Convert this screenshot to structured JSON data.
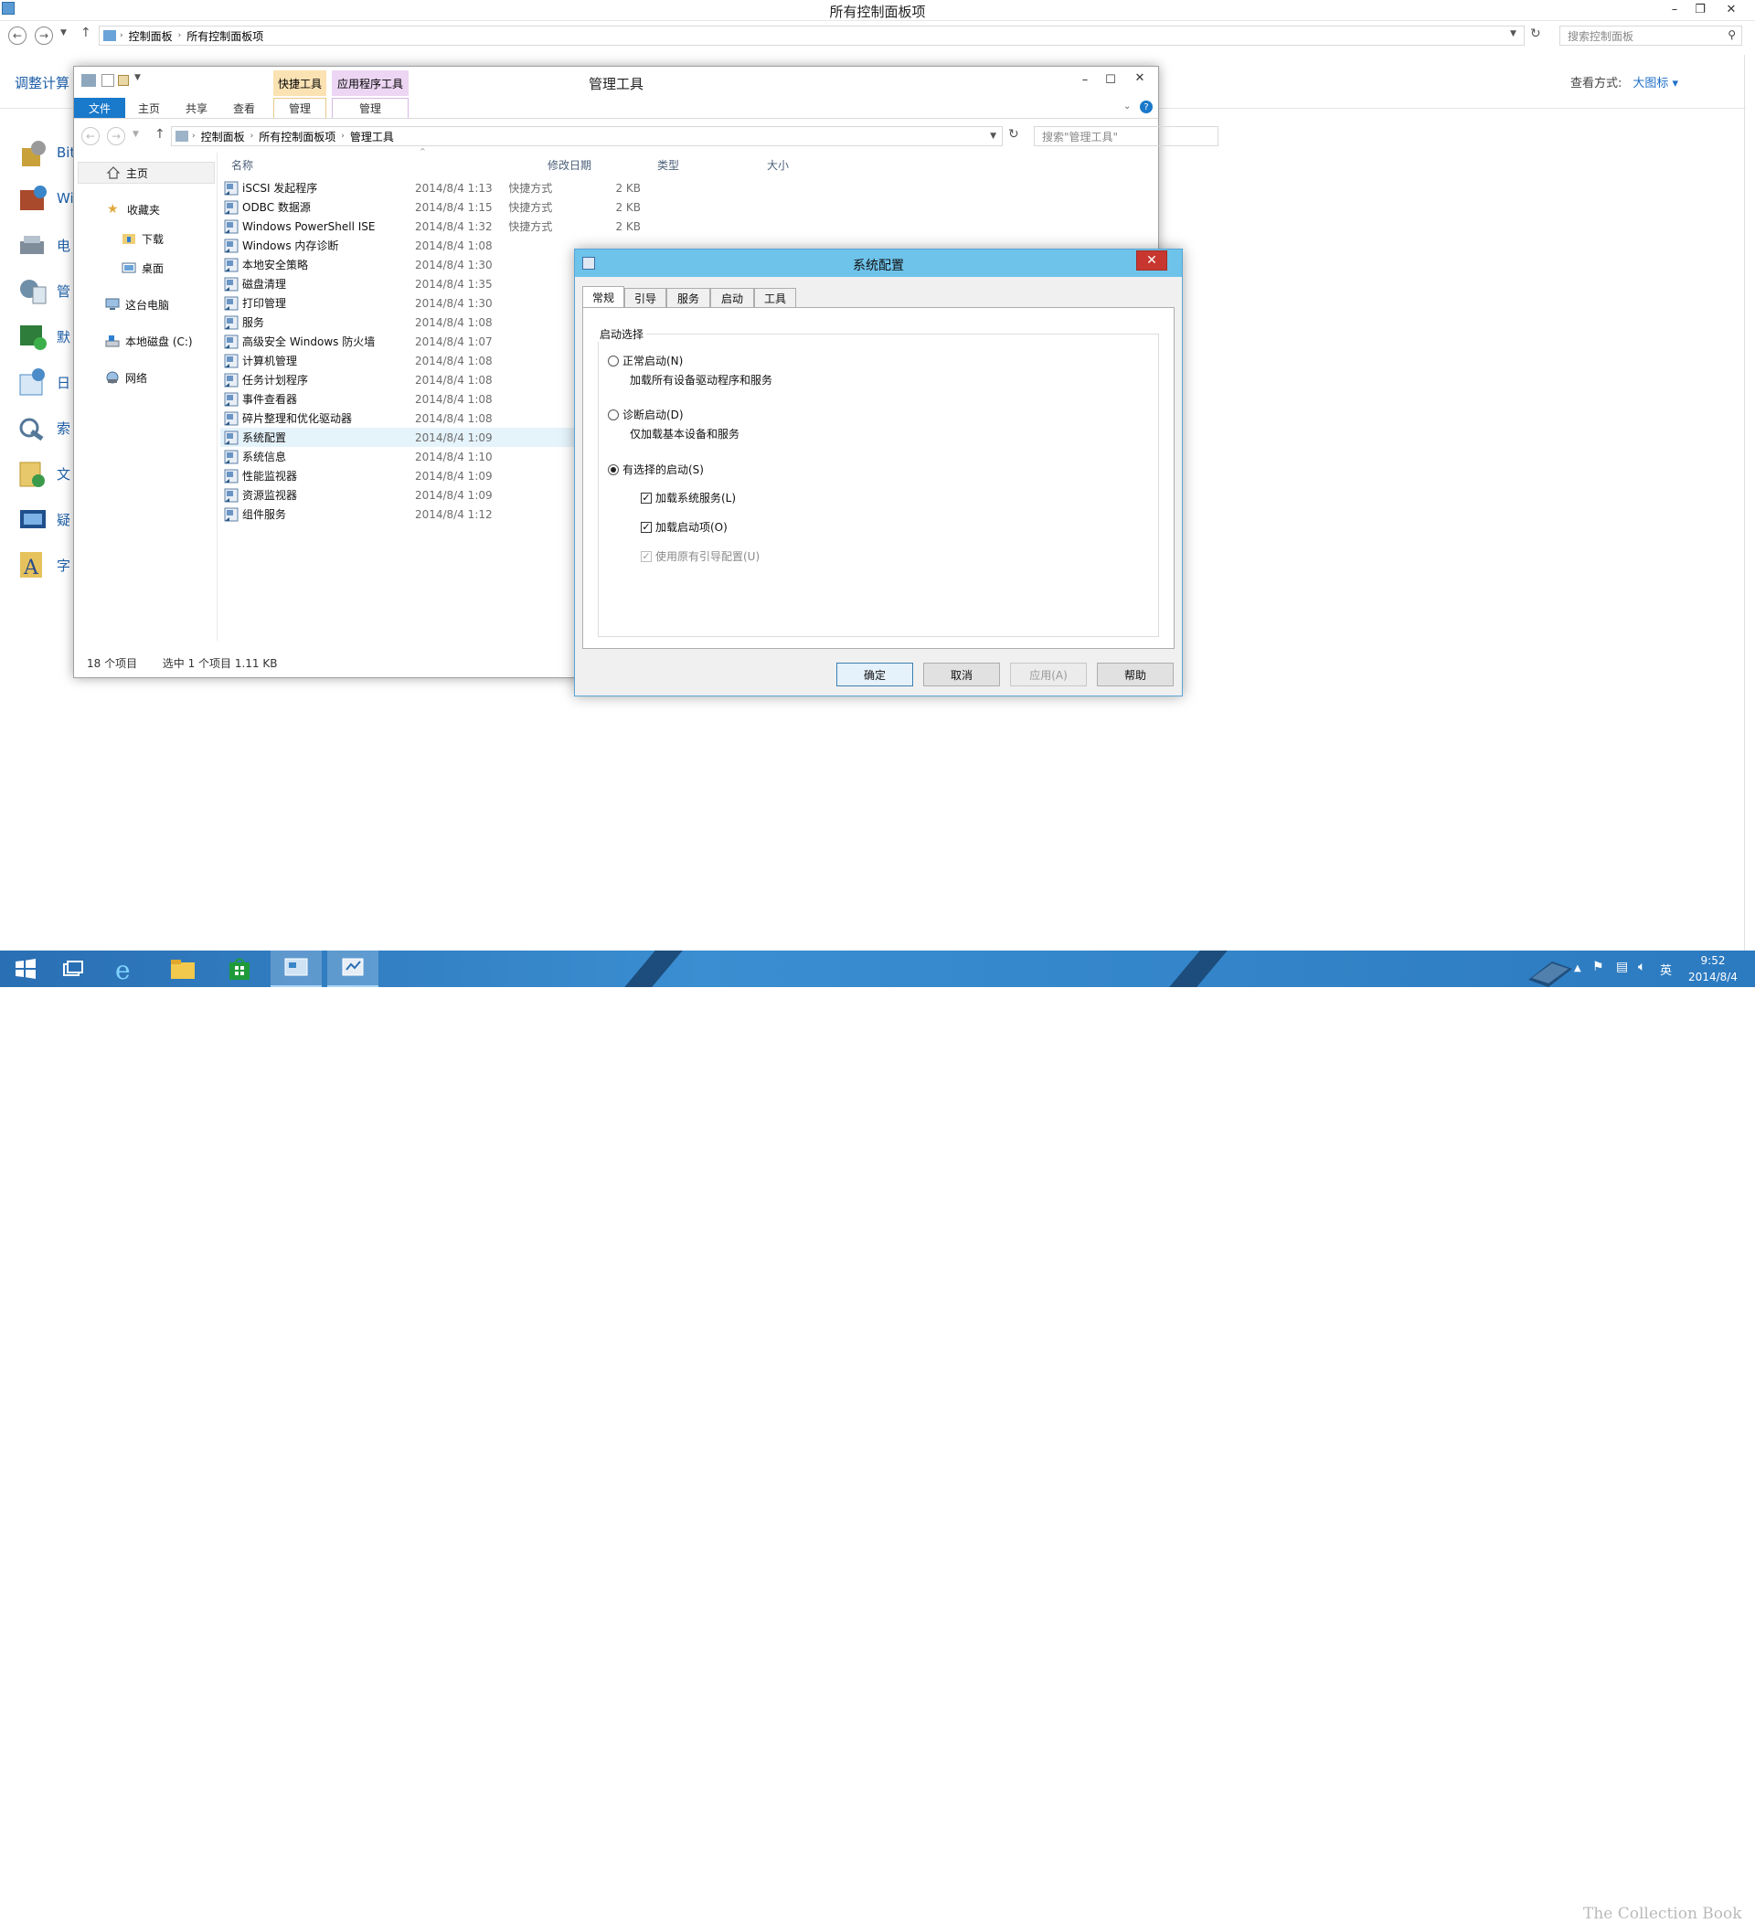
{
  "control_panel": {
    "title": "所有控制面板项",
    "breadcrumb": [
      "控制面板",
      "所有控制面板项"
    ],
    "search_placeholder": "搜索控制面板",
    "left_title": "调整计算",
    "view_label": "查看方式:",
    "view_value": "大图标 ▾",
    "items": [
      "Bit",
      "Wi",
      "电",
      "管",
      "默",
      "日",
      "索",
      "文",
      "疑",
      "字"
    ]
  },
  "explorer": {
    "title": "管理工具",
    "context_tabs": [
      "快捷工具",
      "应用程序工具"
    ],
    "ribbon_tabs": [
      "文件",
      "主页",
      "共享",
      "查看",
      "管理",
      "管理"
    ],
    "breadcrumb": [
      "控制面板",
      "所有控制面板项",
      "管理工具"
    ],
    "search_placeholder": "搜索\"管理工具\"",
    "nav": {
      "home": "主页",
      "favorites": "收藏夹",
      "downloads": "下载",
      "desktop": "桌面",
      "this_pc": "这台电脑",
      "local_disk": "本地磁盘 (C:)",
      "network": "网络"
    },
    "columns": [
      "名称",
      "修改日期",
      "类型",
      "大小"
    ],
    "files": [
      {
        "name": "iSCSI 发起程序",
        "date": "2014/8/4 1:13",
        "type": "快捷方式",
        "size": "2 KB"
      },
      {
        "name": "ODBC 数据源",
        "date": "2014/8/4 1:15",
        "type": "快捷方式",
        "size": "2 KB"
      },
      {
        "name": "Windows PowerShell ISE",
        "date": "2014/8/4 1:32",
        "type": "快捷方式",
        "size": "2 KB"
      },
      {
        "name": "Windows 内存诊断",
        "date": "2014/8/4 1:08",
        "type": "",
        "size": ""
      },
      {
        "name": "本地安全策略",
        "date": "2014/8/4 1:30",
        "type": "",
        "size": ""
      },
      {
        "name": "磁盘清理",
        "date": "2014/8/4 1:35",
        "type": "",
        "size": ""
      },
      {
        "name": "打印管理",
        "date": "2014/8/4 1:30",
        "type": "",
        "size": ""
      },
      {
        "name": "服务",
        "date": "2014/8/4 1:08",
        "type": "",
        "size": ""
      },
      {
        "name": "高级安全 Windows 防火墙",
        "date": "2014/8/4 1:07",
        "type": "",
        "size": ""
      },
      {
        "name": "计算机管理",
        "date": "2014/8/4 1:08",
        "type": "",
        "size": ""
      },
      {
        "name": "任务计划程序",
        "date": "2014/8/4 1:08",
        "type": "",
        "size": ""
      },
      {
        "name": "事件查看器",
        "date": "2014/8/4 1:08",
        "type": "",
        "size": ""
      },
      {
        "name": "碎片整理和优化驱动器",
        "date": "2014/8/4 1:08",
        "type": "",
        "size": ""
      },
      {
        "name": "系统配置",
        "date": "2014/8/4 1:09",
        "type": "",
        "size": "",
        "selected": true
      },
      {
        "name": "系统信息",
        "date": "2014/8/4 1:10",
        "type": "",
        "size": ""
      },
      {
        "name": "性能监视器",
        "date": "2014/8/4 1:09",
        "type": "",
        "size": ""
      },
      {
        "name": "资源监视器",
        "date": "2014/8/4 1:09",
        "type": "",
        "size": ""
      },
      {
        "name": "组件服务",
        "date": "2014/8/4 1:12",
        "type": "",
        "size": ""
      }
    ],
    "status_count": "18 个项目",
    "status_selected": "选中 1 个项目  1.11 KB"
  },
  "msconfig": {
    "title": "系统配置",
    "tabs": [
      "常规",
      "引导",
      "服务",
      "启动",
      "工具"
    ],
    "active_tab": "常规",
    "group_label": "启动选择",
    "normal_startup": "正常启动(N)",
    "normal_desc": "加载所有设备驱动程序和服务",
    "diagnostic_startup": "诊断启动(D)",
    "diagnostic_desc": "仅加载基本设备和服务",
    "selective_startup": "有选择的启动(S)",
    "load_system_services": "加载系统服务(L)",
    "load_startup_items": "加载启动项(O)",
    "use_original_boot": "使用原有引导配置(U)",
    "buttons": {
      "ok": "确定",
      "cancel": "取消",
      "apply": "应用(A)",
      "help": "帮助"
    }
  },
  "taskbar": {
    "time": "9:52",
    "date": "2014/8/4",
    "ime": "英",
    "watermark": "The Collection Book"
  },
  "colors": {
    "accent": "#1979ca",
    "dialog_title": "#6ec3ea",
    "close_red": "#c7372f",
    "taskbar": "#2f80c6"
  }
}
